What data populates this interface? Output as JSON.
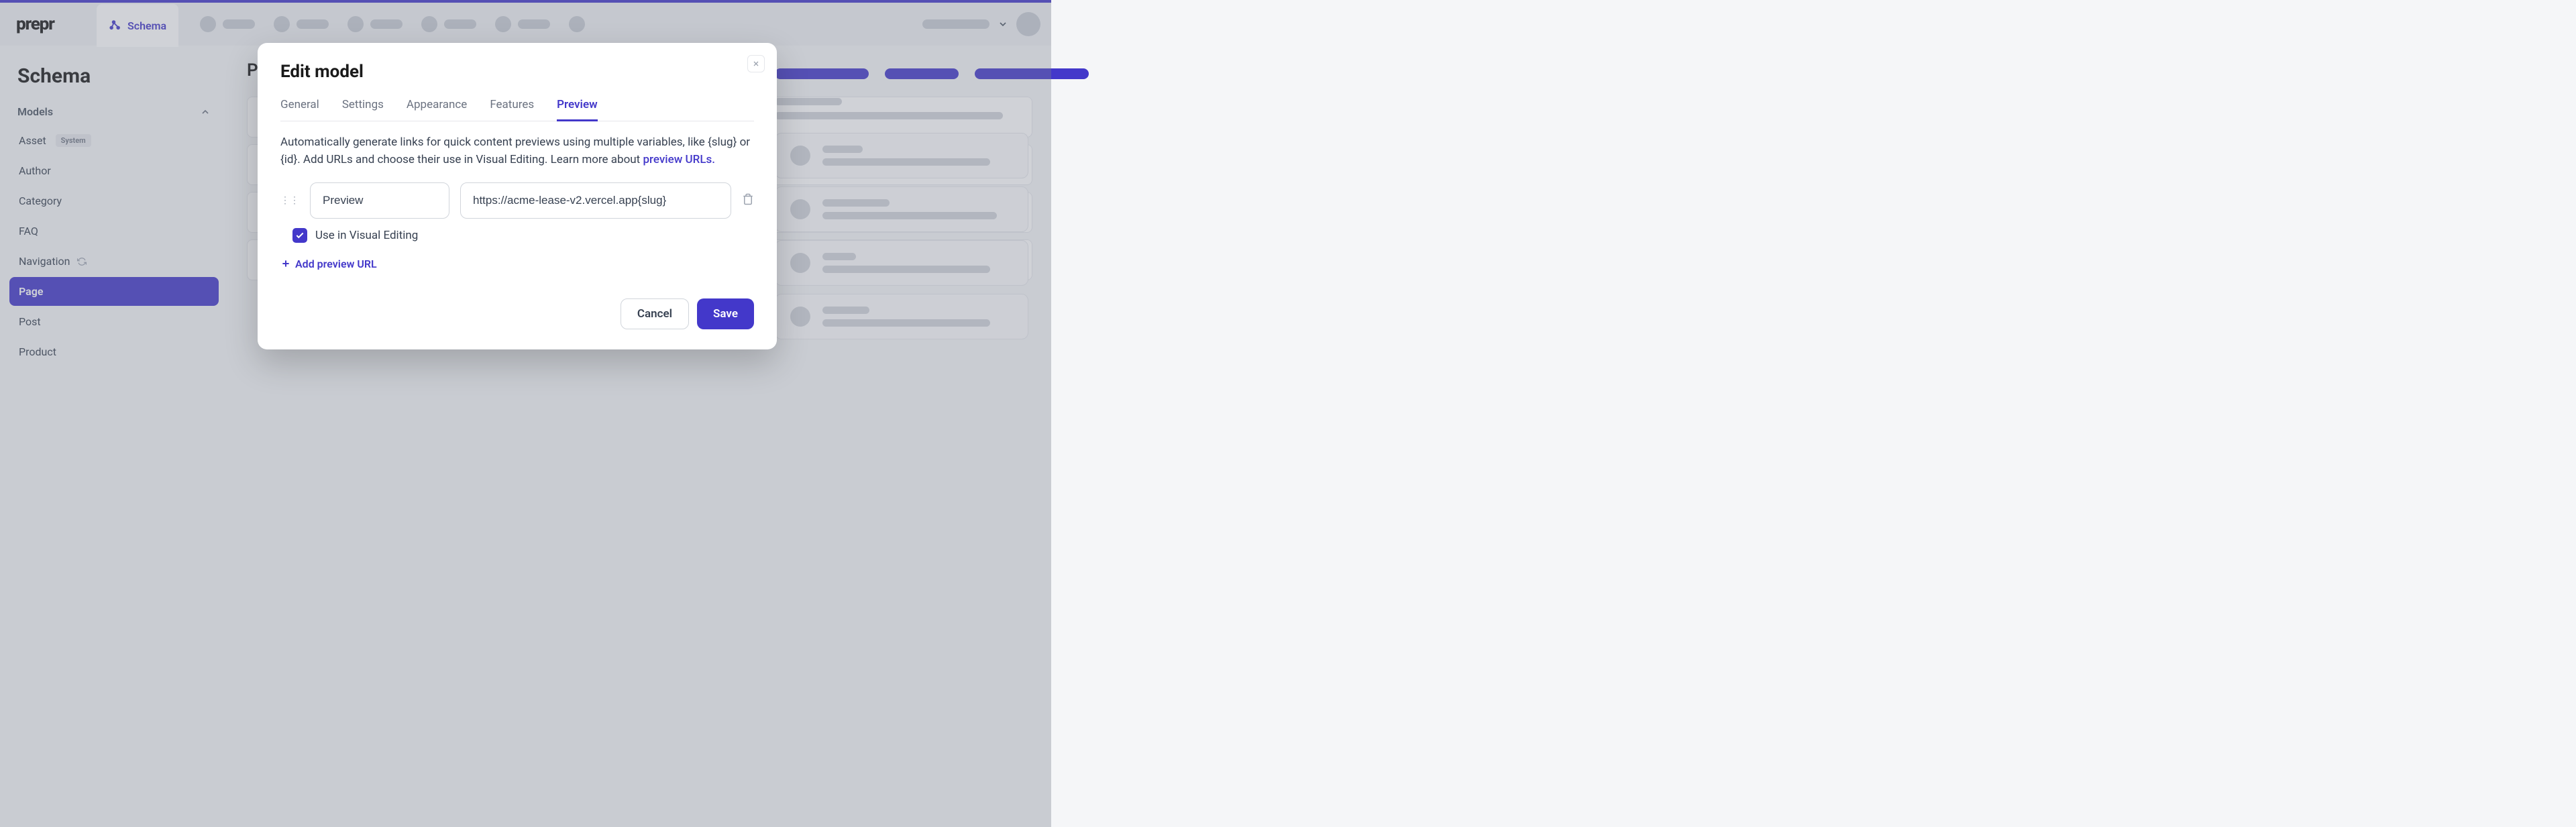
{
  "app": {
    "name": "prepr"
  },
  "nav": {
    "active_tab_label": "Schema"
  },
  "sidebar": {
    "title": "Schema",
    "group_label": "Models",
    "items": [
      {
        "label": "Asset",
        "system": true
      },
      {
        "label": "Author"
      },
      {
        "label": "Category"
      },
      {
        "label": "FAQ"
      },
      {
        "label": "Navigation",
        "refresh": true
      },
      {
        "label": "Page",
        "active": true
      },
      {
        "label": "Post"
      },
      {
        "label": "Product"
      }
    ],
    "system_badge": "System"
  },
  "content": {
    "title_prefix": "Pa"
  },
  "modal": {
    "title": "Edit model",
    "tabs": [
      "General",
      "Settings",
      "Appearance",
      "Features",
      "Preview"
    ],
    "active_tab": "Preview",
    "description_pre": "Automatically generate links for quick content previews using multiple variables, like {slug} or {id}. Add URLs and choose their use in Visual Editing. Learn more about ",
    "description_link": "preview URLs.",
    "url_row": {
      "name_value": "Preview",
      "url_value": "https://acme-lease-v2.vercel.app{slug}"
    },
    "checkbox_label": "Use in Visual Editing",
    "checkbox_checked": true,
    "add_preview_label": "Add preview URL",
    "cancel_label": "Cancel",
    "save_label": "Save"
  }
}
